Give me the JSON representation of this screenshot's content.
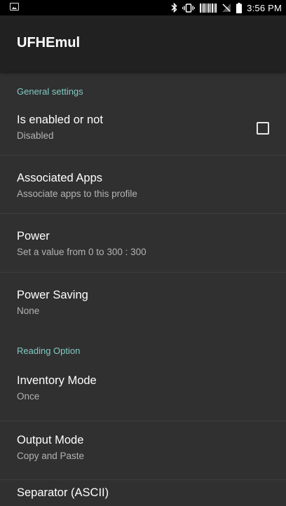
{
  "status_bar": {
    "time": "3:56 PM",
    "icons": [
      "gallery-icon",
      "bluetooth-icon",
      "vibrate-icon",
      "barcode-icon",
      "no-signal-icon",
      "battery-icon"
    ]
  },
  "app_bar": {
    "title": "UFHEmul"
  },
  "sections": {
    "general": {
      "header": "General settings",
      "enabled": {
        "title": "Is enabled or not",
        "summary": "Disabled",
        "checked": false
      },
      "associated_apps": {
        "title": "Associated Apps",
        "summary": "Associate apps to this profile"
      },
      "power": {
        "title": "Power",
        "summary": "Set a value from 0 to 300 : 300"
      },
      "power_saving": {
        "title": "Power Saving",
        "summary": "None"
      }
    },
    "reading": {
      "header": "Reading Option",
      "inventory_mode": {
        "title": "Inventory Mode",
        "summary": "Once"
      },
      "output_mode": {
        "title": "Output Mode",
        "summary": "Copy and Paste"
      },
      "separator": {
        "title": "Separator (ASCII)"
      }
    }
  },
  "colors": {
    "background": "#303030",
    "app_bar": "#212121",
    "accent": "#80cbc4",
    "status_bar": "#000000"
  }
}
